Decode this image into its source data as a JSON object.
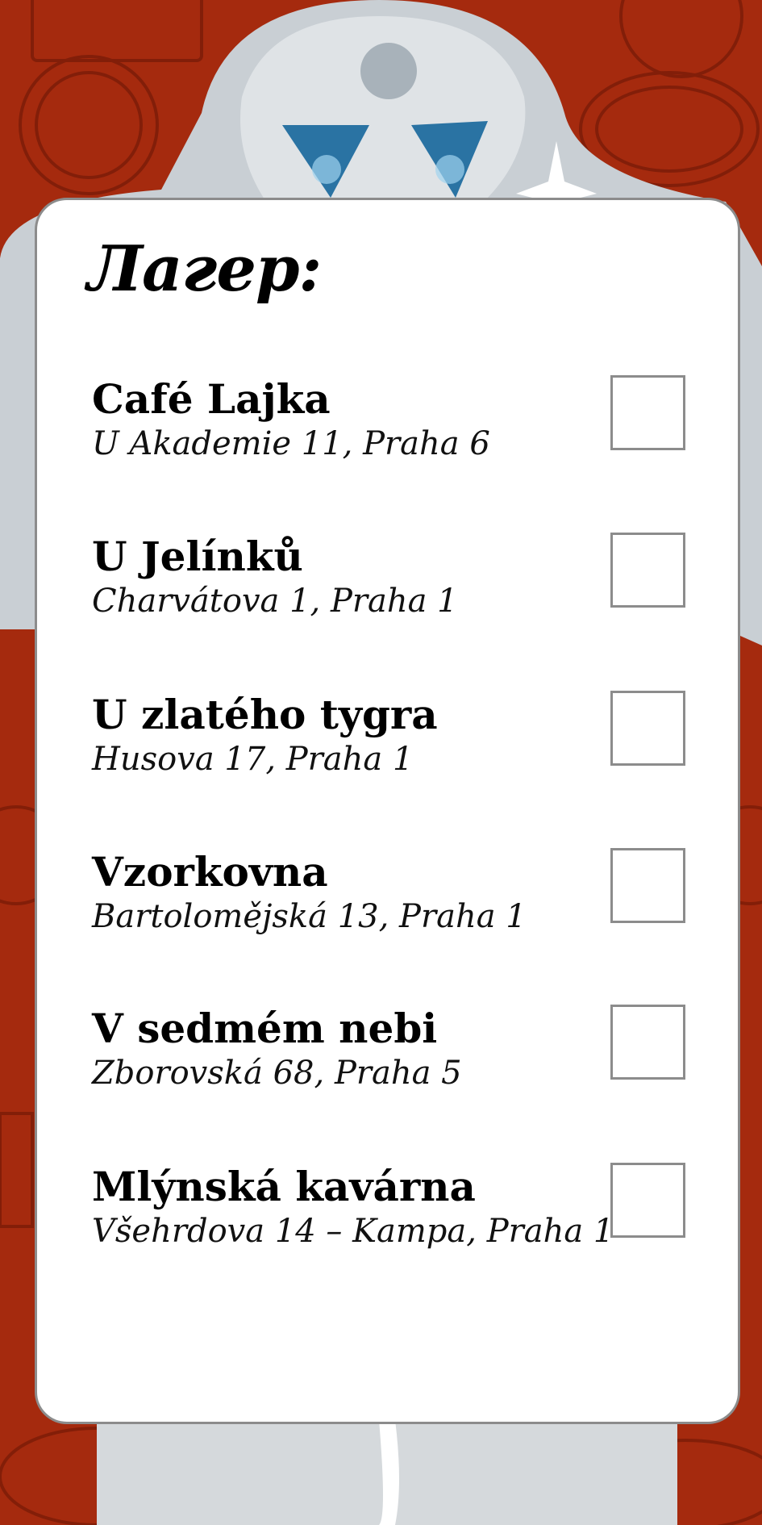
{
  "header": {
    "title": "Лагер:"
  },
  "items": [
    {
      "name": "Café Lajka",
      "address": "U Akademie 11, Praha 6"
    },
    {
      "name": "U Jelínků",
      "address": "Charvátova 1, Praha 1"
    },
    {
      "name": "U zlatého tygra",
      "address": "Husova 17, Praha 1"
    },
    {
      "name": "Vzorkovna",
      "address": "Bartoloměјská 13, Praha 1"
    },
    {
      "name": "V sedmém nebi",
      "address": "Zborovská 68, Praha 5"
    },
    {
      "name": "Mlýnská kavárna",
      "address": "Všehrdova 14 – Kampa, Praha 1"
    }
  ],
  "colors": {
    "background": "#a52a0e",
    "card": "#ffffff",
    "border": "#8c8c8c"
  }
}
